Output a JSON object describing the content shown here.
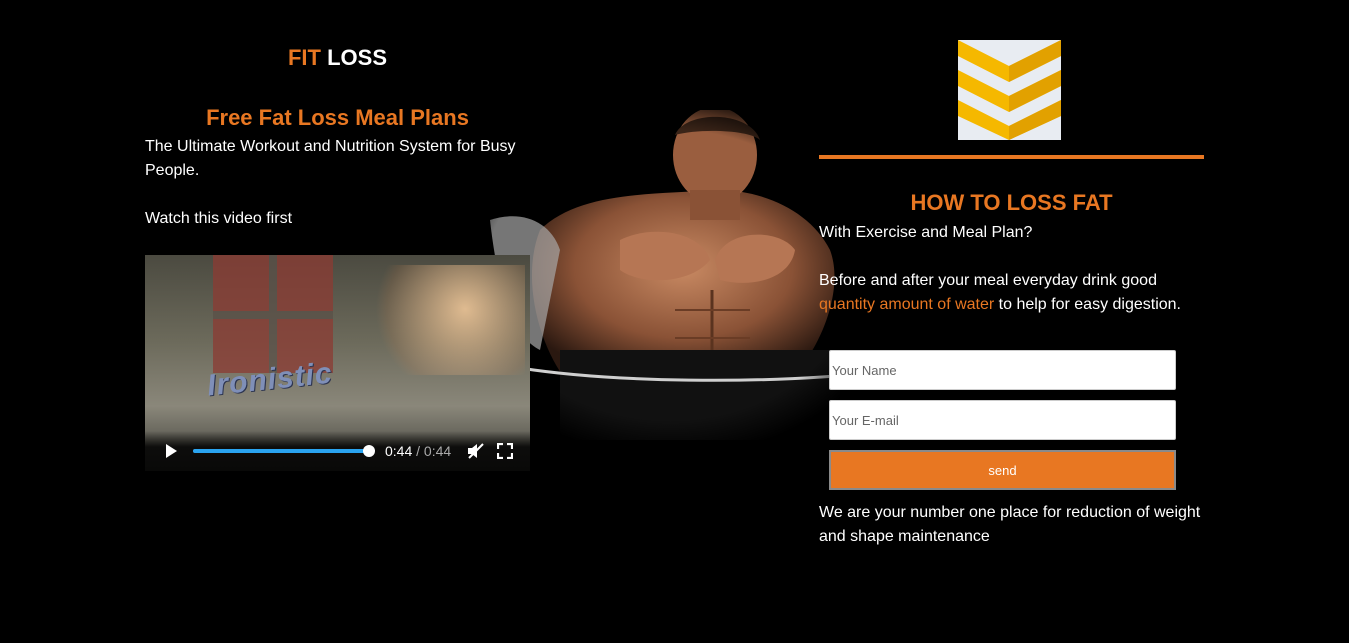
{
  "brand": {
    "part1": "FIT",
    "part2": "LOSS"
  },
  "left": {
    "headline": "Free Fat Loss Meal Plans",
    "intro": "The Ultimate Workout and Nutrition System for Busy People.",
    "watch": "Watch this video first"
  },
  "video": {
    "overlay_text": "Ironistic",
    "current_time": "0:44",
    "separator": "/",
    "duration": "0:44",
    "progress_fraction": 1.0,
    "accent": "#2aa4f0"
  },
  "right": {
    "title": "HOW TO LOSS FAT",
    "subtitle": "With Exercise and Meal Plan?",
    "body_before": "Before and after your meal everyday drink good ",
    "body_link": "quantity amount of water",
    "body_after": " to help for easy digestion.",
    "tagline": "We are your number one place for reduction of weight and shape maintenance"
  },
  "form": {
    "name_placeholder": "Your Name",
    "email_placeholder": "Your E-mail",
    "send_label": "send"
  },
  "colors": {
    "accent": "#e87722",
    "background": "#000000",
    "logo_yellow": "#f5b800"
  },
  "icons": [
    "play-icon",
    "mute-icon",
    "fullscreen-icon",
    "chevron-logo-icon"
  ]
}
